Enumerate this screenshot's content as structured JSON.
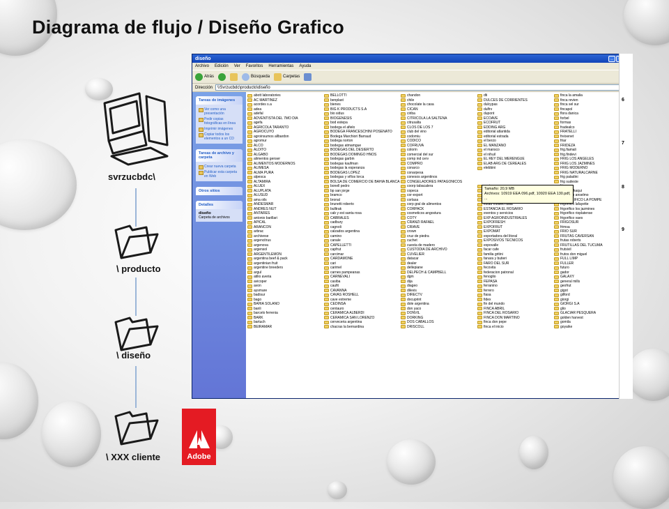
{
  "slide": {
    "title": "Diagrama de flujo / Diseño Grafico",
    "labels": {
      "server": "svrzucbdc\\",
      "producto": "\\ producto",
      "diseno": "\\ diseño",
      "cliente": "\\ XXX cliente"
    },
    "adobe_text": "Adobe",
    "colors": {
      "adobe_red": "#e41b23",
      "xp_blue": "#1345b8",
      "flow_line": "#9bb6d8"
    }
  },
  "window": {
    "title": "diseño",
    "menu": [
      "Archivo",
      "Edición",
      "Ver",
      "Favoritos",
      "Herramientas",
      "Ayuda"
    ],
    "toolbar": {
      "back": "Atrás",
      "search": "Búsqueda",
      "folders": "Carpetas"
    },
    "address": {
      "label": "Dirección",
      "value": "\\\\Svrzucbdc\\producto\\diseño",
      "go": "Ir"
    },
    "tasks": {
      "image_title": "Tareas de imágenes",
      "image_items": [
        "Ver como una presentación",
        "Pedir copias fotográficas en línea",
        "Imprimir imágenes",
        "Copiar todos los elementos a un CD"
      ],
      "file_title": "Tareas de archivo y carpeta",
      "file_items": [
        "Crear nueva carpeta",
        "Publicar esta carpeta en Web"
      ],
      "other_title": "Otros sitios",
      "details_title": "Detalles",
      "details_name": "diseño",
      "details_type": "Carpeta de archivos"
    },
    "tooltip": {
      "line1": "Tamaño: 20,9 MB",
      "line2": "Archivos: 10919 EEA 096.pdf, 10920 EEA 130.pdf, ..."
    },
    "columns": [
      [
        "abott laboratories",
        "AC MARTINEZ",
        "acordes s.a",
        "adea",
        "adefal",
        "ADVENTISTA DEL 7MO DIA",
        "agefa",
        "AGRICOLA TARANTO",
        "AGROCUYO",
        "agroinsumos allbardon",
        "agromur",
        "ALCO",
        "ALDITO",
        "ALGABO",
        "alimentos genser",
        "ALIMENTOS MODERNOS",
        "ALIMESA",
        "ALMA PURA",
        "alpesca",
        "ALTAMIRA",
        "ALUEX",
        "ALUPLATA",
        "ALUSUD",
        "ama oils",
        "ANDESMAR",
        "ANDRES NUT",
        "ANTARES",
        "antonio barillari",
        "APICAL",
        "ARANCON",
        "arbrac",
        "archivese",
        "argencitrus",
        "argenova",
        "argensol",
        "ARGENTILEMON",
        "argentina beef & pack",
        "argentinian fruit",
        "argentine breeders",
        "argul",
        "atilio averia",
        "avicoper",
        "avon",
        "aysmare",
        "badisur",
        "bago",
        "BAHIA SOLANO",
        "banli",
        "barcelo ferrenia",
        "BARK",
        "bartuch",
        "BEIRAMAR"
      ],
      [
        "BELLOTTI",
        "benplast",
        "bienes",
        "BIG K PRODUCTS S.A",
        "bio sidus",
        "BIOGENESIS",
        "bod estepa",
        "bodega el afielo",
        "BODEGA FRANCESCHINI POSENATO",
        "Bodega Marchiori Barraud",
        "bodega norton",
        "bodegas atmamgue",
        "BODEGAS DEL DESIERTO",
        "BODEGAS DOMINGO HNOS",
        "bodegas garbin",
        "bodegas kaufman",
        "bodegas la esperanza",
        "BODEGAS LOPEZ",
        "bodegas y viños lorca",
        "BOLSA DE COMERCIO DE BAHIA BLANCA",
        "bonell pedro",
        "bp san jorge",
        "bramco",
        "bronal",
        "brunetti roberto",
        "bulltrak",
        "cab y est santa rosa",
        "CABRALES",
        "cadbury",
        "cagnoli",
        "calzados argentina",
        "camino",
        "canale",
        "CAPELLETTI",
        "capfrut",
        "carcimar",
        "CARDAMONE",
        "cari",
        "carimel",
        "carnes pampeanas",
        "CARNEVALI",
        "casiba",
        "caufit",
        "CAVANNA",
        "CAVAS ROSHELL",
        "cave extreme",
        "CEDINSA",
        "centauro",
        "CERAMICA ALBERDI",
        "CERAMICA SAN LORENZO",
        "cerveceria argentina",
        "chacras la bernardina"
      ],
      [
        "chandon",
        "chile",
        "chocolate la casa",
        "CICAN",
        "ciriba",
        "CITRICOLA LA SALTEÑA",
        "citrusalta",
        "CLOS DE LOS 7",
        "club del vino",
        "codomiu",
        "CODICO",
        "COFRUVA",
        "colorin",
        "comercial del sur",
        "comp ind cerv",
        "COMPRO",
        "conarco",
        "conarpesa",
        "conesos argentinos",
        "CONGELADORES PATAGONICOS",
        "coorp tabacalera",
        "copeca",
        "cor-export",
        "corlasa",
        "corp gral de alimentos",
        "CORPACK",
        "cosmeticos angostura",
        "COTY",
        "CRANZI RAFAEL",
        "CRIAVE",
        "crown",
        "cruz de piedra",
        "cuchet",
        "cuesta de madero",
        "CUSTODIA DE ARCHIVO",
        "CUVELIER",
        "datacar",
        "dealer",
        "dellepiane",
        "DELPECH & CAMPBELL",
        "dgm",
        "dija",
        "diageo",
        "dilevis",
        "DIRECTV",
        "docuprint",
        "dole argentina",
        "don yaco",
        "DONVIL",
        "DORKING",
        "DOS CABALLOS",
        "DRISCOLL"
      ],
      [
        "dti",
        "DULCES DE CORRIENTES",
        "dulcypas",
        "dulfrv",
        "dupont",
        "ECOAVE",
        "ECOFRUT",
        "EDDING ARG",
        "editorial atlantida",
        "editorial estrada",
        "el berzo",
        "EL MANZANO",
        "el mansco",
        "el nihuil",
        "EL REY DEL MERENGUE",
        "ELAB ARG DE CEREALES",
        "elebbini",
        "",
        "",
        "",
        "envirogreen",
        "ESCUELA SALESIANA DEL VALLE",
        "est graf impresores",
        "estab del plata",
        "estab modelo italia",
        "ESTANCIA EL ROSARIO",
        "eventos y servicios",
        "EXP AGROINDUSTRIALES",
        "EXPOFRESH",
        "EXPOFRUT",
        "EXPOMAT",
        "exportadora del litoral",
        "EXPOSIVOS TECNICOS",
        "expovalle",
        "facar cafe",
        "familia gritini",
        "fanara y butieri",
        "FARO DEL SUR",
        "fecovita",
        "federacion patronal",
        "fenoglio",
        "FEPASA",
        "ferranino",
        "ferrero",
        "fiasa",
        "fidex",
        "fin del mundo",
        "FINCA ABRIL",
        "FINCA DEL ROSARIO",
        "FINCA DON MARTINO",
        "finca don pepe",
        "finca el inicio"
      ],
      [
        "finca la amalia",
        "finca revien",
        "finca sel sur",
        "fincapol",
        "flora danica",
        "forbel",
        "formas",
        "fradealco",
        "FRATELLI",
        "freixenet",
        "friar",
        "FRIDEZA",
        "frig.fiamali",
        "frig.findevi",
        "FRIG LOS ANGELES",
        "FRIG LOS JAZMINES",
        "FRIG MODERNO",
        "FRIG NATURALCARNE",
        "frig paladini",
        "frig sudeste",
        "frig vare",
        "frig. calchaqui",
        "frigorifico anselmo",
        "FRIGORIFICO LA POMPE",
        "frigorifico lafayette",
        "frigorifico los jazmines",
        "frigorifico rioplatense",
        "frigorifico vaes",
        "FRIGOSUR",
        "frimsa",
        "FRIO SUR",
        "FRUTAS CAVERSAN",
        "frutas roberts",
        "FRUTILLAS DEL TUCUMA",
        "frutsivil",
        "frutos don miguel",
        "FULL LIMP",
        "FULLER",
        "futuro",
        "gador",
        "GALAXY",
        "general mills",
        "geofrut",
        "gigot",
        "gilford",
        "giorgi",
        "GIORGI S.A",
        "glio",
        "GLACIAR PESQUERA",
        "golden harvest",
        "gomila",
        "goyaike"
      ]
    ],
    "strip_numbers": [
      "6",
      "7",
      "8",
      "9"
    ]
  }
}
